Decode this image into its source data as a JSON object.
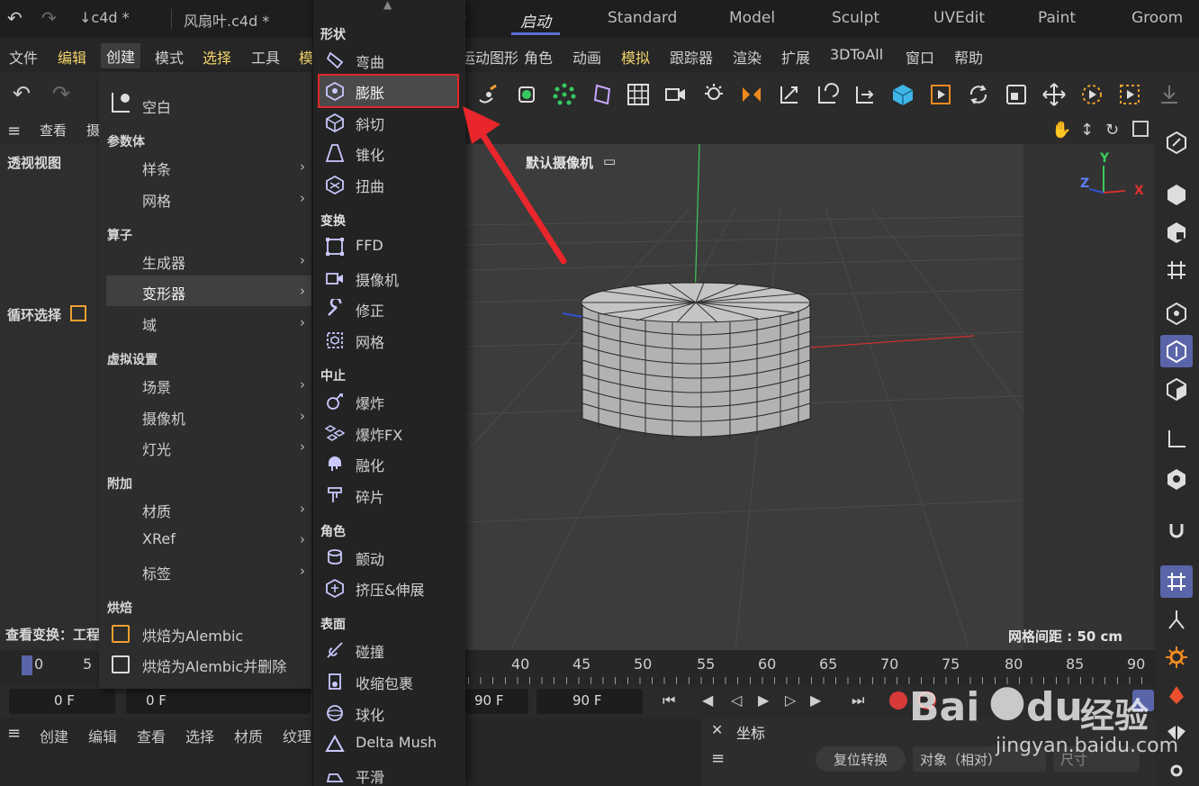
{
  "titlebar": {
    "file_tab_1": "↓c4d *",
    "file_tab_2": "风扇叶.c4d *",
    "layout_tabs": [
      "启动",
      "Standard",
      "Model",
      "Sculpt",
      "UVEdit",
      "Paint",
      "Groom"
    ]
  },
  "menubar": {
    "items": [
      "文件",
      "编辑",
      "创建",
      "模式",
      "选择",
      "工具",
      "模"
    ],
    "items_right": [
      "运动图形",
      "角色",
      "动画",
      "模拟",
      "跟踪器",
      "渲染",
      "扩展",
      "3DToAll",
      "窗口",
      "帮助"
    ]
  },
  "leftpanel": {
    "view_menu": "查看",
    "view_menu_2": "摄",
    "viewport_name": "透视视图",
    "loop_select": "循环选择",
    "view_transform": "查看变换：工程"
  },
  "viewport": {
    "camera": "默认摄像机",
    "grid_spacing": "网格间距 : 50 cm",
    "axis_y": "Y",
    "axis_z": "Z",
    "axis_x": "X"
  },
  "create_menu": {
    "empty": "空白",
    "sections": {
      "params": "参数体",
      "operators": "算子",
      "virtual": "虚拟设置",
      "extras": "附加",
      "bake": "烘焙"
    },
    "items": {
      "spline": "样条",
      "mesh": "网格",
      "generator": "生成器",
      "deformer": "变形器",
      "field": "域",
      "scene": "场景",
      "camera": "摄像机",
      "light": "灯光",
      "material": "材质",
      "xref": "XRef",
      "tag": "标签",
      "bake_alembic": "烘焙为Alembic",
      "bake_alembic_delete": "烘焙为Alembic并删除"
    }
  },
  "deformer_menu": {
    "sections": {
      "shape": "形状",
      "transform": "变换",
      "stop": "中止",
      "character": "角色",
      "surface": "表面"
    },
    "items": {
      "bend": "弯曲",
      "bulge": "膨胀",
      "bevel": "斜切",
      "taper": "锥化",
      "twist": "扭曲",
      "ffd": "FFD",
      "camera": "摄像机",
      "correction": "修正",
      "mesh": "网格",
      "explosion": "爆炸",
      "explosion_fx": "爆炸FX",
      "melt": "融化",
      "shatter": "碎片",
      "jiggle": "颤动",
      "squash": "挤压&伸展",
      "collision": "碰撞",
      "shrink_wrap": "收缩包裹",
      "spherify": "球化",
      "delta_mush": "Delta Mush",
      "smooth": "平滑"
    }
  },
  "timeline": {
    "ticks": [
      "0",
      "5",
      "40",
      "45",
      "50",
      "55",
      "60",
      "65",
      "70",
      "75",
      "80",
      "85",
      "90"
    ],
    "frame_start": "0 F",
    "frame_current": "0 F",
    "frame_end_1": "90 F",
    "frame_end_2": "90 F"
  },
  "bottombar": {
    "items": [
      "创建",
      "编辑",
      "查看",
      "选择",
      "材质",
      "纹理"
    ]
  },
  "coords_panel": {
    "title": "坐标",
    "reset_button": "复位转换",
    "mode_select": "对象（相对）",
    "size_select": "尺寸"
  },
  "watermark": {
    "brand": "Bai",
    "brand2": "du",
    "brand_cn": "经验",
    "url": "jingyan.baidu.com"
  },
  "colors": {
    "highlight_border": "#e02828",
    "arrow": "#e8262b",
    "accent": "#5b6fd1",
    "menu_text_yellow": "#f1d36a"
  }
}
